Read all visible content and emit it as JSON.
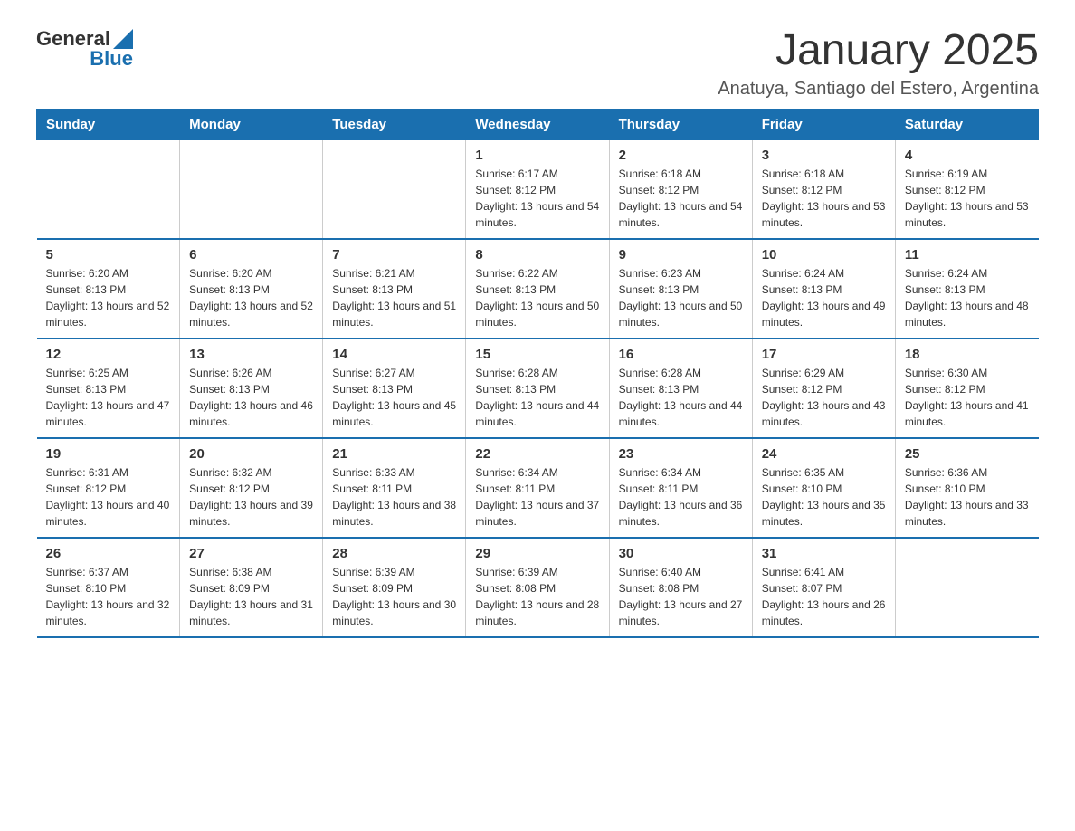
{
  "header": {
    "logo_general": "General",
    "logo_blue": "Blue",
    "month_title": "January 2025",
    "location": "Anatuya, Santiago del Estero, Argentina"
  },
  "days_of_week": [
    "Sunday",
    "Monday",
    "Tuesday",
    "Wednesday",
    "Thursday",
    "Friday",
    "Saturday"
  ],
  "weeks": [
    [
      {
        "day": "",
        "info": ""
      },
      {
        "day": "",
        "info": ""
      },
      {
        "day": "",
        "info": ""
      },
      {
        "day": "1",
        "info": "Sunrise: 6:17 AM\nSunset: 8:12 PM\nDaylight: 13 hours and 54 minutes."
      },
      {
        "day": "2",
        "info": "Sunrise: 6:18 AM\nSunset: 8:12 PM\nDaylight: 13 hours and 54 minutes."
      },
      {
        "day": "3",
        "info": "Sunrise: 6:18 AM\nSunset: 8:12 PM\nDaylight: 13 hours and 53 minutes."
      },
      {
        "day": "4",
        "info": "Sunrise: 6:19 AM\nSunset: 8:12 PM\nDaylight: 13 hours and 53 minutes."
      }
    ],
    [
      {
        "day": "5",
        "info": "Sunrise: 6:20 AM\nSunset: 8:13 PM\nDaylight: 13 hours and 52 minutes."
      },
      {
        "day": "6",
        "info": "Sunrise: 6:20 AM\nSunset: 8:13 PM\nDaylight: 13 hours and 52 minutes."
      },
      {
        "day": "7",
        "info": "Sunrise: 6:21 AM\nSunset: 8:13 PM\nDaylight: 13 hours and 51 minutes."
      },
      {
        "day": "8",
        "info": "Sunrise: 6:22 AM\nSunset: 8:13 PM\nDaylight: 13 hours and 50 minutes."
      },
      {
        "day": "9",
        "info": "Sunrise: 6:23 AM\nSunset: 8:13 PM\nDaylight: 13 hours and 50 minutes."
      },
      {
        "day": "10",
        "info": "Sunrise: 6:24 AM\nSunset: 8:13 PM\nDaylight: 13 hours and 49 minutes."
      },
      {
        "day": "11",
        "info": "Sunrise: 6:24 AM\nSunset: 8:13 PM\nDaylight: 13 hours and 48 minutes."
      }
    ],
    [
      {
        "day": "12",
        "info": "Sunrise: 6:25 AM\nSunset: 8:13 PM\nDaylight: 13 hours and 47 minutes."
      },
      {
        "day": "13",
        "info": "Sunrise: 6:26 AM\nSunset: 8:13 PM\nDaylight: 13 hours and 46 minutes."
      },
      {
        "day": "14",
        "info": "Sunrise: 6:27 AM\nSunset: 8:13 PM\nDaylight: 13 hours and 45 minutes."
      },
      {
        "day": "15",
        "info": "Sunrise: 6:28 AM\nSunset: 8:13 PM\nDaylight: 13 hours and 44 minutes."
      },
      {
        "day": "16",
        "info": "Sunrise: 6:28 AM\nSunset: 8:13 PM\nDaylight: 13 hours and 44 minutes."
      },
      {
        "day": "17",
        "info": "Sunrise: 6:29 AM\nSunset: 8:12 PM\nDaylight: 13 hours and 43 minutes."
      },
      {
        "day": "18",
        "info": "Sunrise: 6:30 AM\nSunset: 8:12 PM\nDaylight: 13 hours and 41 minutes."
      }
    ],
    [
      {
        "day": "19",
        "info": "Sunrise: 6:31 AM\nSunset: 8:12 PM\nDaylight: 13 hours and 40 minutes."
      },
      {
        "day": "20",
        "info": "Sunrise: 6:32 AM\nSunset: 8:12 PM\nDaylight: 13 hours and 39 minutes."
      },
      {
        "day": "21",
        "info": "Sunrise: 6:33 AM\nSunset: 8:11 PM\nDaylight: 13 hours and 38 minutes."
      },
      {
        "day": "22",
        "info": "Sunrise: 6:34 AM\nSunset: 8:11 PM\nDaylight: 13 hours and 37 minutes."
      },
      {
        "day": "23",
        "info": "Sunrise: 6:34 AM\nSunset: 8:11 PM\nDaylight: 13 hours and 36 minutes."
      },
      {
        "day": "24",
        "info": "Sunrise: 6:35 AM\nSunset: 8:10 PM\nDaylight: 13 hours and 35 minutes."
      },
      {
        "day": "25",
        "info": "Sunrise: 6:36 AM\nSunset: 8:10 PM\nDaylight: 13 hours and 33 minutes."
      }
    ],
    [
      {
        "day": "26",
        "info": "Sunrise: 6:37 AM\nSunset: 8:10 PM\nDaylight: 13 hours and 32 minutes."
      },
      {
        "day": "27",
        "info": "Sunrise: 6:38 AM\nSunset: 8:09 PM\nDaylight: 13 hours and 31 minutes."
      },
      {
        "day": "28",
        "info": "Sunrise: 6:39 AM\nSunset: 8:09 PM\nDaylight: 13 hours and 30 minutes."
      },
      {
        "day": "29",
        "info": "Sunrise: 6:39 AM\nSunset: 8:08 PM\nDaylight: 13 hours and 28 minutes."
      },
      {
        "day": "30",
        "info": "Sunrise: 6:40 AM\nSunset: 8:08 PM\nDaylight: 13 hours and 27 minutes."
      },
      {
        "day": "31",
        "info": "Sunrise: 6:41 AM\nSunset: 8:07 PM\nDaylight: 13 hours and 26 minutes."
      },
      {
        "day": "",
        "info": ""
      }
    ]
  ]
}
